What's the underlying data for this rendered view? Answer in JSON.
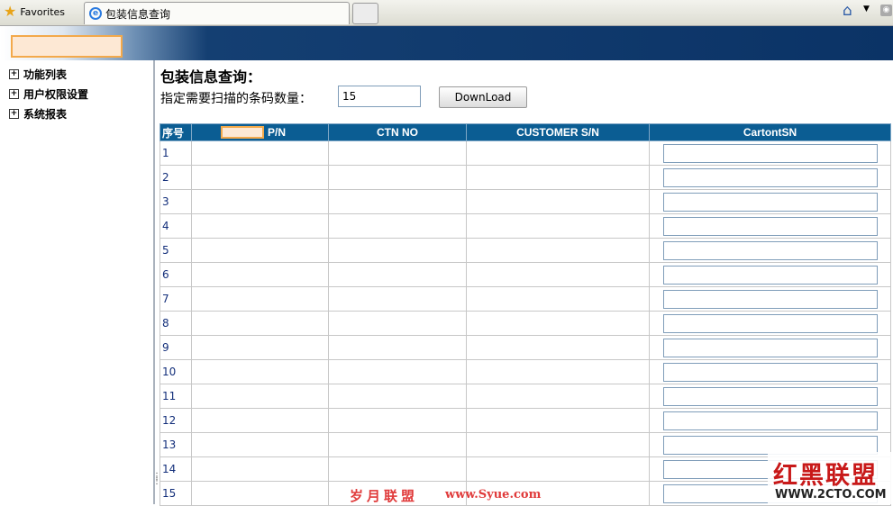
{
  "browser": {
    "favorites_label": "Favorites",
    "tab_title": "包装信息查询",
    "ie_icon_glyph": "e",
    "home_icon": "home-icon",
    "rss_icon": "rss-icon"
  },
  "sidebar": {
    "items": [
      {
        "label": "功能列表"
      },
      {
        "label": "用户权限设置"
      },
      {
        "label": "系统报表"
      }
    ]
  },
  "main": {
    "title": "包装信息查询：",
    "scan_label": "指定需要扫描的条码数量：",
    "scan_count": "15",
    "download_label": "DownLoad"
  },
  "table": {
    "headers": [
      "序号",
      "P/N",
      "CTN NO",
      "CUSTOMER S/N",
      "CartontSN"
    ],
    "rows": [
      "1",
      "2",
      "3",
      "4",
      "5",
      "6",
      "7",
      "8",
      "9",
      "10",
      "11",
      "12",
      "13",
      "14",
      "15"
    ]
  },
  "watermarks": {
    "center_cn": "岁月联盟",
    "center_url": "www.Syue.com",
    "corner_logo": "红黑联盟",
    "corner_url": "WWW.2CTO.COM"
  },
  "colors": {
    "header_bg": "#0b5d93",
    "banner_dark": "#0b3366",
    "accent_orange": "#f3a94b"
  }
}
